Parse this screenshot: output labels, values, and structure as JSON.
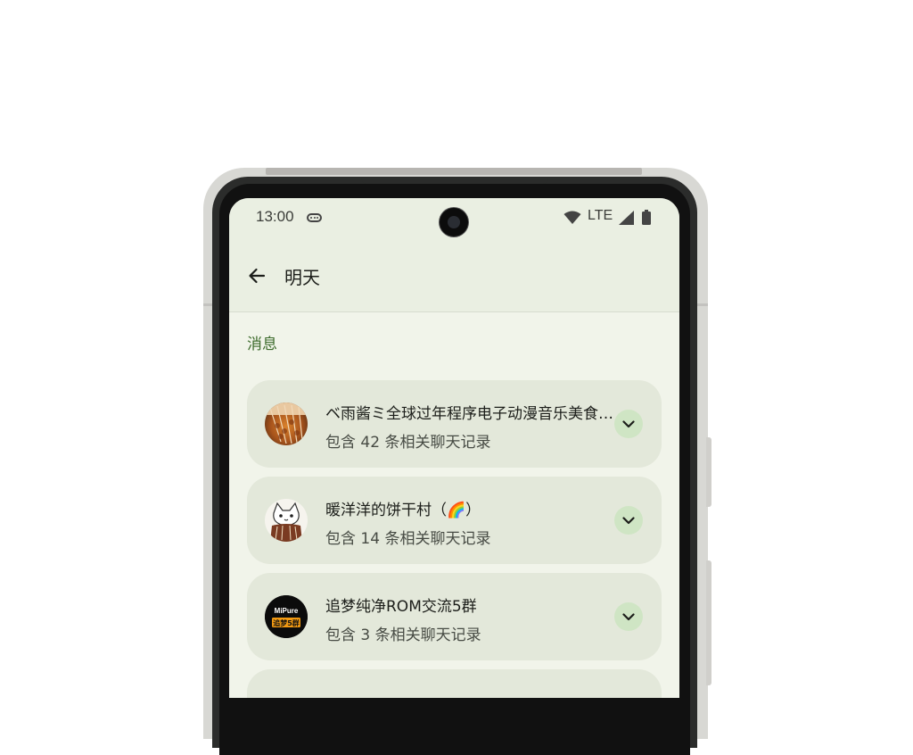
{
  "status_bar": {
    "time": "13:00",
    "network": "LTE",
    "icons": [
      "message-icon",
      "wifi-icon",
      "signal-icon",
      "battery-icon"
    ]
  },
  "app_bar": {
    "back_icon": "arrow-left-icon",
    "title": "明天"
  },
  "section": {
    "label": "消息"
  },
  "chats": [
    {
      "name": "ベ雨酱ミ全球过年程序电子动漫音乐美食交流群",
      "subtitle": "包含 42 条相关聊天记录",
      "avatar": "skewers-photo"
    },
    {
      "name": "暖洋洋的饼干村（🌈）",
      "subtitle": "包含 14 条相关聊天记录",
      "avatar": "cartoon-cat"
    },
    {
      "name": "追梦纯净ROM交流5群",
      "subtitle": "包含 3 条相关聊天记录",
      "avatar": "mipure-logo",
      "avatar_text_top": "MiPure",
      "avatar_text_bottom": "追梦5群"
    }
  ],
  "colors": {
    "accent": "#3d6b2c",
    "card": "#e3e8da",
    "expand_button": "#cfe5c4",
    "background": "#f1f4ea"
  }
}
